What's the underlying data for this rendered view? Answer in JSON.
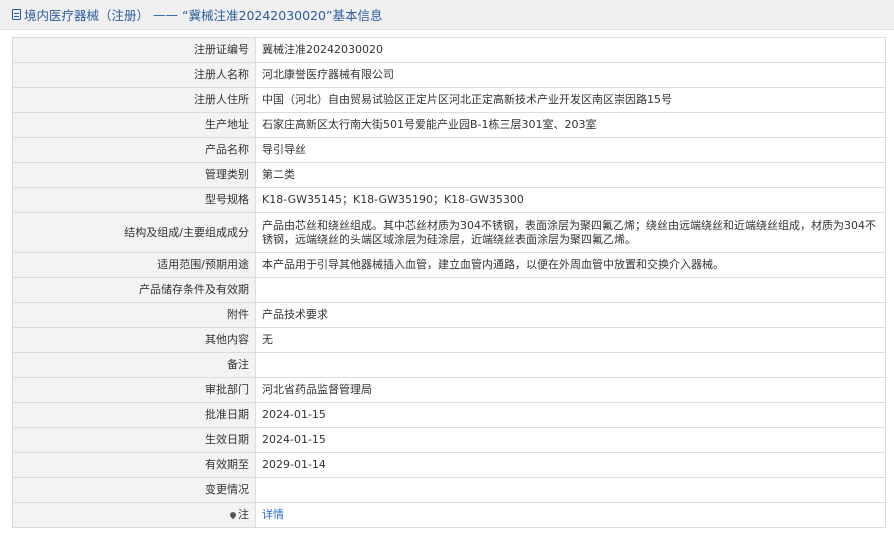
{
  "header": {
    "prefix": "境内医疗器械（注册）",
    "dash": "——",
    "title": "“冀械注准20242030020”基本信息"
  },
  "rows": [
    {
      "label": "注册证编号",
      "value": "冀械注准20242030020"
    },
    {
      "label": "注册人名称",
      "value": "河北康誉医疗器械有限公司"
    },
    {
      "label": "注册人住所",
      "value": "中国（河北）自由贸易试验区正定片区河北正定高新技术产业开发区南区崇因路15号"
    },
    {
      "label": "生产地址",
      "value": "石家庄高新区太行南大街501号爱能产业园B-1栋三层301室、203室"
    },
    {
      "label": "产品名称",
      "value": "导引导丝"
    },
    {
      "label": "管理类别",
      "value": "第二类"
    },
    {
      "label": "型号规格",
      "value": "K18-GW35145；K18-GW35190；K18-GW35300"
    },
    {
      "label": "结构及组成/主要组成成分",
      "value": "产品由芯丝和绕丝组成。其中芯丝材质为304不锈钢，表面涂层为聚四氟乙烯；绕丝由远端绕丝和近端绕丝组成，材质为304不锈钢，远端绕丝的头端区域涂层为硅涂层，近端绕丝表面涂层为聚四氟乙烯。"
    },
    {
      "label": "适用范围/预期用途",
      "value": "本产品用于引导其他器械插入血管，建立血管内通路，以便在外周血管中放置和交换介入器械。"
    },
    {
      "label": "产品储存条件及有效期",
      "value": ""
    },
    {
      "label": "附件",
      "value": "产品技术要求"
    },
    {
      "label": "其他内容",
      "value": "无"
    },
    {
      "label": "备注",
      "value": ""
    },
    {
      "label": "审批部门",
      "value": "河北省药品监督管理局"
    },
    {
      "label": "批准日期",
      "value": "2024-01-15"
    },
    {
      "label": "生效日期",
      "value": "2024-01-15"
    },
    {
      "label": "有效期至",
      "value": "2029-01-14"
    },
    {
      "label": "变更情况",
      "value": ""
    },
    {
      "label": "注",
      "value": "详情"
    }
  ]
}
